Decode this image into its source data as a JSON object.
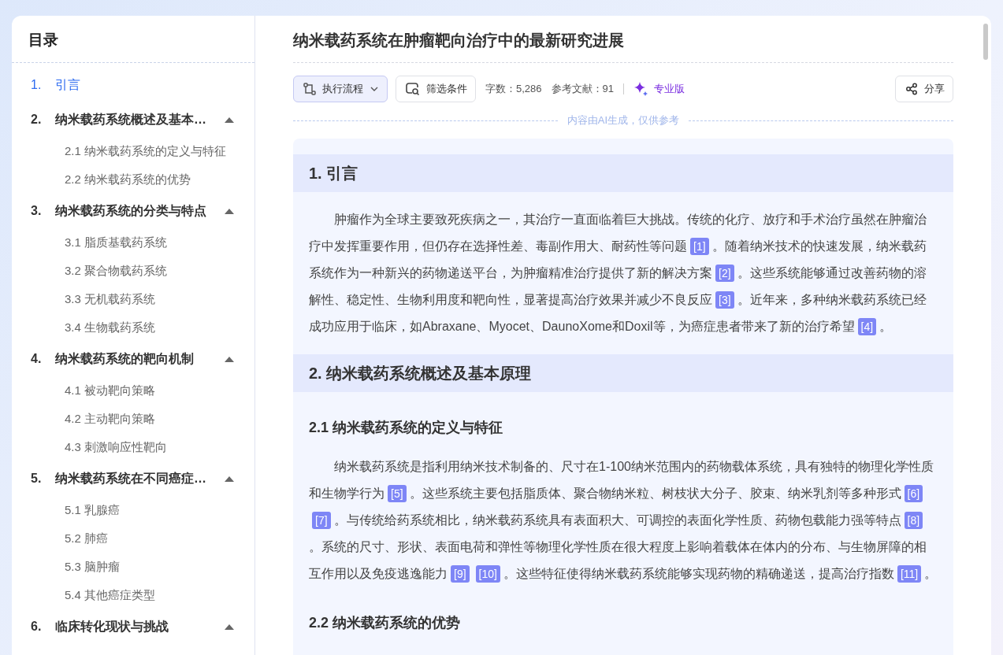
{
  "sidebar": {
    "title": "目录",
    "chapters": [
      {
        "number": "1.",
        "title": "引言",
        "selected": true
      },
      {
        "number": "2.",
        "title": "纳米载药系统概述及基本…",
        "selected": false,
        "expanded": true,
        "children": [
          {
            "title": "2.1 纳米载药系统的定义与特征",
            "selected": false
          },
          {
            "title": "2.2 纳米载药系统的优势",
            "selected": false
          }
        ]
      },
      {
        "number": "3.",
        "title": "纳米载药系统的分类与特点",
        "selected": false,
        "expanded": true,
        "children": [
          {
            "title": "3.1 脂质基载药系统",
            "selected": false
          },
          {
            "title": "3.2 聚合物载药系统",
            "selected": false
          },
          {
            "title": "3.3 无机载药系统",
            "selected": false
          },
          {
            "title": "3.4 生物载药系统",
            "selected": false
          }
        ]
      },
      {
        "number": "4.",
        "title": "纳米载药系统的靶向机制",
        "selected": false,
        "expanded": true,
        "children": [
          {
            "title": "4.1 被动靶向策略",
            "selected": false
          },
          {
            "title": "4.2 主动靶向策略",
            "selected": false
          },
          {
            "title": "4.3 刺激响应性靶向",
            "selected": false
          }
        ]
      },
      {
        "number": "5.",
        "title": "纳米载药系统在不同癌症…",
        "selected": false,
        "expanded": true,
        "children": [
          {
            "title": "5.1 乳腺癌",
            "selected": false
          },
          {
            "title": "5.2 肺癌",
            "selected": false
          },
          {
            "title": "5.3 脑肿瘤",
            "selected": false
          },
          {
            "title": "5.4 其他癌症类型",
            "selected": false
          }
        ]
      },
      {
        "number": "6.",
        "title": "临床转化现状与挑战",
        "selected": false,
        "expanded": true
      }
    ]
  },
  "document": {
    "title": "纳米载药系统在肿瘤靶向治疗中的最新研究进展",
    "toolbar": {
      "workflow_button": "执行流程",
      "filter_button": "筛选条件",
      "word_count": "字数：5,286",
      "references": "参考文献：91",
      "edition": "专业版",
      "share_button": "分享"
    },
    "ai_notice": "内容由AI生成，仅供参考",
    "blocks": [
      {
        "kind": "h1",
        "text": "1. 引言"
      },
      {
        "kind": "paragraph",
        "parts": [
          {
            "text": "肿瘤作为全球主要致死疾病之一，其治疗一直面临着巨大挑战。传统的化疗、放疗和手术治疗虽然在肿瘤治疗中发挥重要作用，但仍存在选择性差、毒副作用大、耐药性等问题"
          },
          {
            "cite": "[1]"
          },
          {
            "text": "。随着纳米技术的快速发展，纳米载药系统作为一种新兴的药物递送平台，为肿瘤精准治疗提供了新的解决方案"
          },
          {
            "cite": "[2]"
          },
          {
            "text": "。这些系统能够通过改善药物的溶解性、稳定性、生物利用度和靶向性，显著提高治疗效果并减少不良反应"
          },
          {
            "cite": "[3]"
          },
          {
            "text": "。近年来，多种纳米载药系统已经成功应用于临床，如Abraxane、Myocet、DaunoXome和Doxil等，为癌症患者带来了新的治疗希望"
          },
          {
            "cite": "[4]"
          },
          {
            "text": "。"
          }
        ]
      },
      {
        "kind": "h1",
        "text": "2. 纳米载药系统概述及基本原理"
      },
      {
        "kind": "h2",
        "text": "2.1 纳米载药系统的定义与特征"
      },
      {
        "kind": "paragraph",
        "parts": [
          {
            "text": "纳米载药系统是指利用纳米技术制备的、尺寸在1-100纳米范围内的药物载体系统，具有独特的物理化学性质和生物学行为"
          },
          {
            "cite": "[5]"
          },
          {
            "text": "。这些系统主要包括脂质体、聚合物纳米粒、树枝状大分子、胶束、纳米乳剂等多种形式"
          },
          {
            "cite": "[6]"
          },
          {
            "cite": "[7]"
          },
          {
            "text": "。与传统给药系统相比，纳米载药系统具有表面积大、可调控的表面化学性质、药物包载能力强等特点"
          },
          {
            "cite": "[8]"
          },
          {
            "text": "。系统的尺寸、形状、表面电荷和弹性等物理化学性质在很大程度上影响着载体在体内的分布、与生物屏障的相互作用以及免疫逃逸能力"
          },
          {
            "cite": "[9]"
          },
          {
            "cite": "[10]"
          },
          {
            "text": "。这些特征使得纳米载药系统能够实现药物的精确递送，提高治疗指数"
          },
          {
            "cite": "[11]"
          },
          {
            "text": "。"
          }
        ]
      },
      {
        "kind": "h2",
        "text": "2.2 纳米载药系统的优势"
      }
    ]
  }
}
